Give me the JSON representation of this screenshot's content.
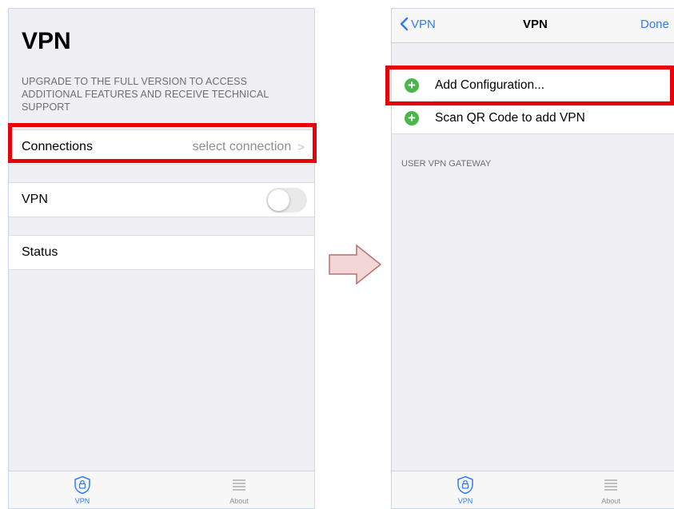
{
  "left_screen": {
    "title": "VPN",
    "upgrade_note": "UPGRADE TO THE FULL VERSION TO ACCESS ADDITIONAL FEATURES AND RECEIVE TECHNICAL SUPPORT",
    "rows": {
      "connections": {
        "label": "Connections",
        "detail": "select connection",
        "chevron": ">"
      },
      "vpn": {
        "label": "VPN",
        "toggle_on": false
      },
      "status": {
        "label": "Status"
      }
    }
  },
  "right_screen": {
    "nav": {
      "back_label": "VPN",
      "title": "VPN",
      "done_label": "Done"
    },
    "items": [
      {
        "label": "Add Configuration...",
        "icon": "plus-circle-icon"
      },
      {
        "label": "Scan QR Code to add VPN",
        "icon": "plus-circle-icon"
      }
    ],
    "section_header": "USER VPN GATEWAY"
  },
  "tabbar": {
    "tabs": [
      {
        "label": "VPN",
        "icon": "shield-lock-icon",
        "active": true
      },
      {
        "label": "About",
        "icon": "list-icon",
        "active": false
      }
    ]
  },
  "colors": {
    "accent": "#2f7cf6",
    "highlight": "#e8000b",
    "add_icon": "#49b649",
    "arrow_fill": "#f3d6d6",
    "arrow_stroke": "#b87070"
  }
}
